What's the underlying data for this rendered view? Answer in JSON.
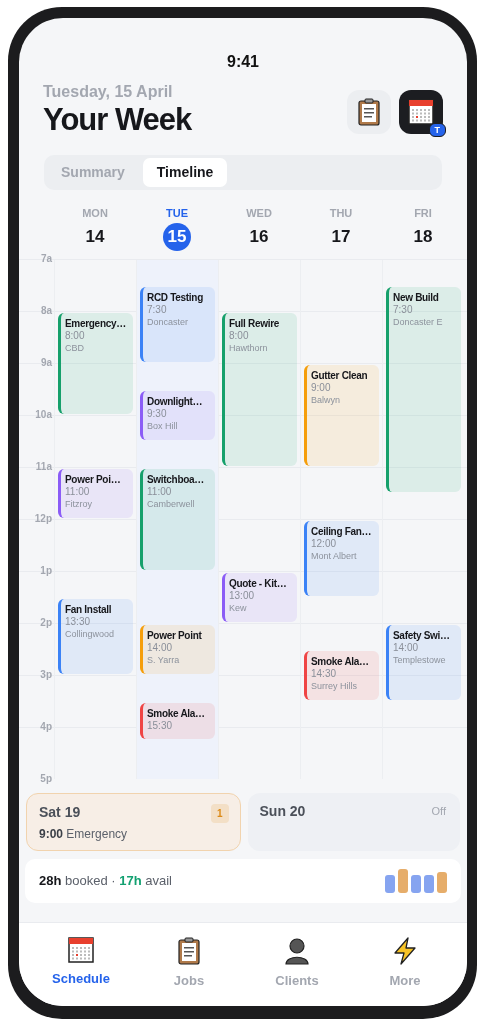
{
  "status_bar": {
    "time": "9:41"
  },
  "header": {
    "date": "Tuesday, 15 April",
    "title": "Your Week",
    "badge": "T"
  },
  "view_tabs": [
    {
      "label": "Summary",
      "selected": false
    },
    {
      "label": "Timeline",
      "selected": true
    }
  ],
  "hours": [
    "7a",
    "8a",
    "9a",
    "10a",
    "11a",
    "12p",
    "1p",
    "2p",
    "3p",
    "4p",
    "5p"
  ],
  "days": [
    {
      "weekday": "MON",
      "date": "14",
      "selected": false,
      "events": [
        {
          "title": "Emergency…",
          "time": "8:00",
          "location": "CBD",
          "color": "#16a06b"
        },
        {
          "title": "Power Poi…",
          "time": "11:00",
          "location": "Fitzroy",
          "color": "#8b5cf6"
        },
        {
          "title": "Fan Install",
          "time": "13:30",
          "location": "Collingwood",
          "color": "#3b82f6"
        }
      ]
    },
    {
      "weekday": "TUE",
      "date": "15",
      "selected": true,
      "events": [
        {
          "title": "RCD Testing",
          "time": "7:30",
          "location": "Doncaster",
          "color": "#3b82f6"
        },
        {
          "title": "Downlight…",
          "time": "9:30",
          "location": "Box Hill",
          "color": "#8b5cf6"
        },
        {
          "title": "Switchboa…",
          "time": "11:00",
          "location": "Camberwell",
          "color": "#16a06b"
        },
        {
          "title": "Power Point",
          "time": "14:00",
          "location": "S. Yarra",
          "color": "#f59e0b"
        },
        {
          "title": "Smoke Ala…",
          "time": "15:30",
          "color": "#ef4444"
        }
      ]
    },
    {
      "weekday": "WED",
      "date": "16",
      "selected": false,
      "events": [
        {
          "title": "Full Rewire",
          "time": "8:00",
          "location": "Hawthorn",
          "color": "#16a06b"
        },
        {
          "title": "Quote - Kit…",
          "time": "13:00",
          "location": "Kew",
          "color": "#8b5cf6"
        }
      ]
    },
    {
      "weekday": "THU",
      "date": "17",
      "selected": false,
      "events": [
        {
          "title": "Gutter Clean",
          "time": "9:00",
          "location": "Balwyn",
          "color": "#f59e0b"
        },
        {
          "title": "Ceiling Fan…",
          "time": "12:00",
          "location": "Mont Albert",
          "color": "#3b82f6"
        },
        {
          "title": "Smoke Ala…",
          "time": "14:30",
          "location": "Surrey Hills",
          "color": "#ef4444"
        }
      ]
    },
    {
      "weekday": "FRI",
      "date": "18",
      "selected": false,
      "events": [
        {
          "title": "New Build",
          "time": "7:30",
          "location": "Doncaster E",
          "color": "#16a06b"
        },
        {
          "title": "Safety Swi…",
          "time": "14:00",
          "location": "Templestowe",
          "color": "#3b82f6"
        }
      ]
    }
  ],
  "weekend": [
    {
      "kind": "booked",
      "day": "Sat 19",
      "count": "1",
      "detail": "**9:00** Emergency"
    },
    {
      "kind": "off",
      "day": "Sun 20",
      "status": "Off"
    }
  ],
  "summary": {
    "text": "**28h** booked · **17h** avail"
  },
  "nav": [
    {
      "label": "Schedule",
      "selected": true
    },
    {
      "label": "Jobs",
      "selected": false
    },
    {
      "label": "Clients",
      "selected": false
    },
    {
      "label": "More",
      "selected": false
    }
  ]
}
